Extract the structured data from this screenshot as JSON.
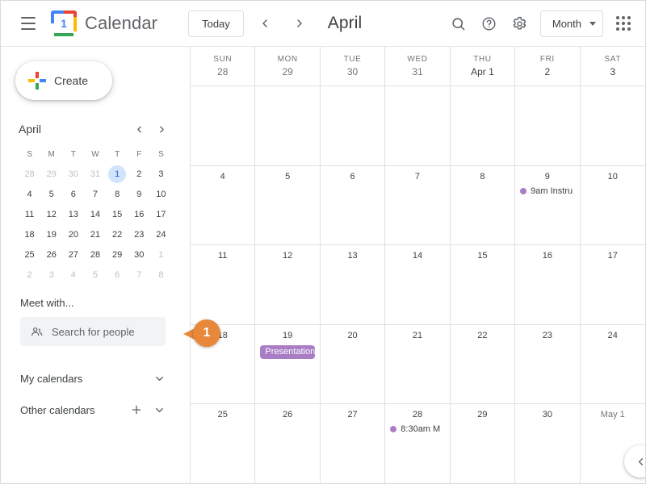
{
  "header": {
    "menu_icon": "hamburger-menu-icon",
    "logo_day": "1",
    "app_title": "Calendar",
    "today_label": "Today",
    "prev_icon": "chevron-left-icon",
    "next_icon": "chevron-right-icon",
    "month_title": "April",
    "search_icon": "search-icon",
    "help_icon": "help-icon",
    "settings_icon": "gear-icon",
    "view_label": "Month",
    "view_caret_icon": "chevron-down-icon",
    "apps_icon": "apps-grid-icon"
  },
  "sidebar": {
    "create_label": "Create",
    "create_icon": "plus-icon",
    "mini": {
      "month": "April",
      "prev_icon": "chevron-left-icon",
      "next_icon": "chevron-right-icon",
      "dow": [
        "S",
        "M",
        "T",
        "W",
        "T",
        "F",
        "S"
      ],
      "days": [
        {
          "n": "28",
          "muted": true
        },
        {
          "n": "29",
          "muted": true
        },
        {
          "n": "30",
          "muted": true
        },
        {
          "n": "31",
          "muted": true
        },
        {
          "n": "1",
          "today": true
        },
        {
          "n": "2"
        },
        {
          "n": "3"
        },
        {
          "n": "4"
        },
        {
          "n": "5"
        },
        {
          "n": "6"
        },
        {
          "n": "7"
        },
        {
          "n": "8"
        },
        {
          "n": "9"
        },
        {
          "n": "10"
        },
        {
          "n": "11"
        },
        {
          "n": "12"
        },
        {
          "n": "13"
        },
        {
          "n": "14"
        },
        {
          "n": "15"
        },
        {
          "n": "16"
        },
        {
          "n": "17"
        },
        {
          "n": "18"
        },
        {
          "n": "19"
        },
        {
          "n": "20"
        },
        {
          "n": "21"
        },
        {
          "n": "22"
        },
        {
          "n": "23"
        },
        {
          "n": "24"
        },
        {
          "n": "25"
        },
        {
          "n": "26"
        },
        {
          "n": "27"
        },
        {
          "n": "28"
        },
        {
          "n": "29"
        },
        {
          "n": "30"
        },
        {
          "n": "1",
          "muted": true
        },
        {
          "n": "2",
          "muted": true
        },
        {
          "n": "3",
          "muted": true
        },
        {
          "n": "4",
          "muted": true
        },
        {
          "n": "5",
          "muted": true
        },
        {
          "n": "6",
          "muted": true
        },
        {
          "n": "7",
          "muted": true
        },
        {
          "n": "8",
          "muted": true
        }
      ]
    },
    "meet_with_label": "Meet with...",
    "people_search_placeholder": "Search for people",
    "people_icon": "people-icon",
    "my_calendars_label": "My calendars",
    "my_calendars_chevron": "chevron-down-icon",
    "other_calendars_label": "Other calendars",
    "other_calendars_add_icon": "plus-icon",
    "other_calendars_chevron": "chevron-down-icon"
  },
  "callout": {
    "number": "1"
  },
  "grid": {
    "dow": [
      {
        "name": "SUN",
        "num": "28",
        "muted": true
      },
      {
        "name": "MON",
        "num": "29",
        "muted": true
      },
      {
        "name": "TUE",
        "num": "30",
        "muted": true
      },
      {
        "name": "WED",
        "num": "31",
        "muted": true
      },
      {
        "name": "THU",
        "num": "Apr 1"
      },
      {
        "name": "FRI",
        "num": "2"
      },
      {
        "name": "SAT",
        "num": "3"
      }
    ],
    "event_color": "#a97dc4",
    "weeks": [
      [
        {
          "n": ""
        },
        {
          "n": ""
        },
        {
          "n": ""
        },
        {
          "n": ""
        },
        {
          "n": ""
        },
        {
          "n": ""
        },
        {
          "n": ""
        }
      ],
      [
        {
          "n": "4"
        },
        {
          "n": "5"
        },
        {
          "n": "6"
        },
        {
          "n": "7"
        },
        {
          "n": "8"
        },
        {
          "n": "9",
          "events": [
            {
              "kind": "dot",
              "text": "9am Instru"
            }
          ]
        },
        {
          "n": "10"
        }
      ],
      [
        {
          "n": "11"
        },
        {
          "n": "12"
        },
        {
          "n": "13"
        },
        {
          "n": "14"
        },
        {
          "n": "15"
        },
        {
          "n": "16"
        },
        {
          "n": "17"
        }
      ],
      [
        {
          "n": "18"
        },
        {
          "n": "19",
          "events": [
            {
              "kind": "chip",
              "text": "Presentation"
            }
          ]
        },
        {
          "n": "20"
        },
        {
          "n": "21"
        },
        {
          "n": "22"
        },
        {
          "n": "23"
        },
        {
          "n": "24"
        }
      ],
      [
        {
          "n": "25"
        },
        {
          "n": "26"
        },
        {
          "n": "27"
        },
        {
          "n": "28",
          "events": [
            {
              "kind": "dot",
              "text": "8:30am M"
            }
          ]
        },
        {
          "n": "29"
        },
        {
          "n": "30"
        },
        {
          "n": "May 1",
          "muted": true
        }
      ]
    ],
    "float_prev_icon": "chevron-left-icon"
  }
}
